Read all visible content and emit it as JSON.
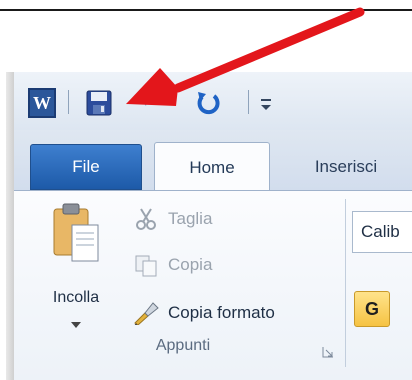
{
  "quick_access": {
    "app_icon_letter": "W",
    "icons": [
      "word-icon",
      "save-icon",
      "undo-icon",
      "redo-icon",
      "customize-icon"
    ]
  },
  "tabs": [
    {
      "label": "File"
    },
    {
      "label": "Home"
    },
    {
      "label": "Inserisci"
    }
  ],
  "clipboard_group": {
    "paste_label": "Incolla",
    "cut_label": "Taglia",
    "copy_label": "Copia",
    "format_painter_label": "Copia formato",
    "group_label": "Appunti"
  },
  "font_group": {
    "font_name": "Calib",
    "bold_label": "G"
  },
  "colors": {
    "file_tab": "#2b6cc4",
    "arrow": "#e3161b",
    "save_icon": "#2c4c9c",
    "redo_icon": "#1f63c5"
  }
}
